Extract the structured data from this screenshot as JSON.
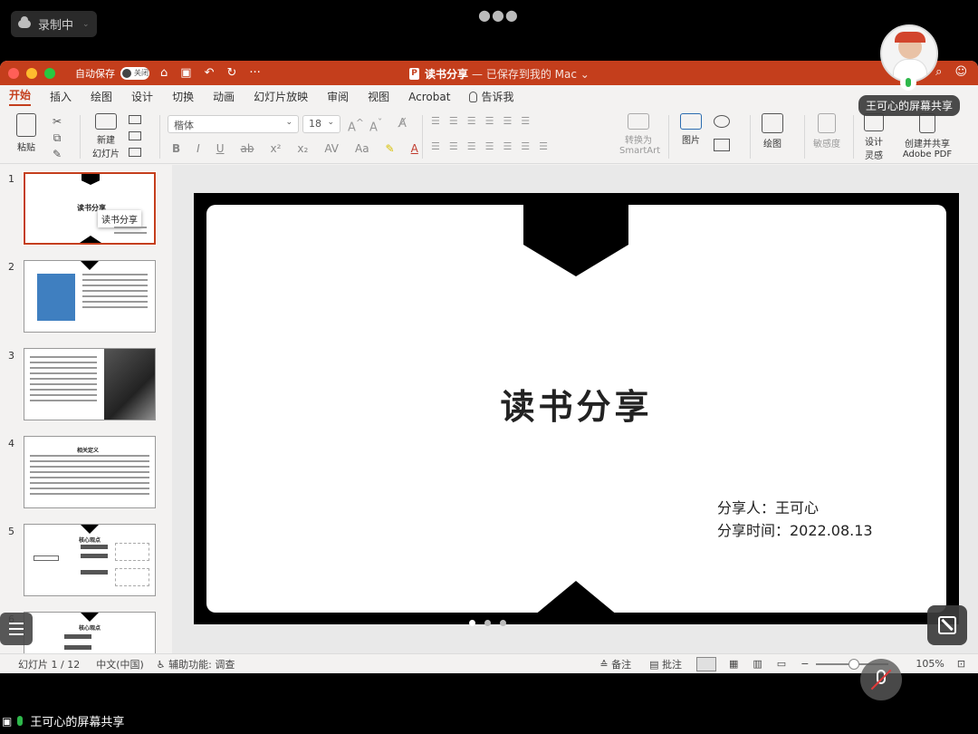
{
  "recording": {
    "label": "录制中"
  },
  "window": {
    "autosave_label": "自动保存",
    "autosave_state": "关闭",
    "doc_title": "读书分享",
    "save_status": "— 已保存到我的 Mac ⌄"
  },
  "menu": {
    "tabs": [
      "开始",
      "插入",
      "绘图",
      "设计",
      "切换",
      "动画",
      "幻灯片放映",
      "审阅",
      "视图",
      "Acrobat"
    ],
    "tell_me": "告诉我"
  },
  "ribbon": {
    "paste": "粘贴",
    "new_slide_1": "新建",
    "new_slide_2": "幻灯片",
    "font_name": "楷体",
    "font_size": "18",
    "convert_1": "转换为",
    "convert_2": "SmartArt",
    "picture": "图片",
    "drawing": "绘图",
    "sensitivity": "敏感度",
    "designer_1": "设计",
    "designer_2": "灵感",
    "adobe_1": "创建并共享",
    "adobe_2": "Adobe PDF"
  },
  "thumbnails": {
    "numbers": [
      "1",
      "2",
      "3",
      "4",
      "5",
      "6"
    ],
    "slide1_title": "读书分享",
    "slide1_tooltip": "读书分享",
    "slide4_title": "相关定义",
    "slide5_title": "核心观点",
    "slide6_title": "核心观点"
  },
  "slide": {
    "title": "读书分享",
    "presenter_line": "分享人：王可心",
    "date_line": "分享时间：2022.08.13"
  },
  "status": {
    "slide_count": "幻灯片 1 / 12",
    "language": "中文(中国)",
    "accessibility": "辅助功能: 调查",
    "notes": "备注",
    "comments": "批注",
    "zoom": "105%"
  },
  "share": {
    "top_label": "王可心的屏幕共享",
    "bottom_label": "王可心的屏幕共享"
  }
}
